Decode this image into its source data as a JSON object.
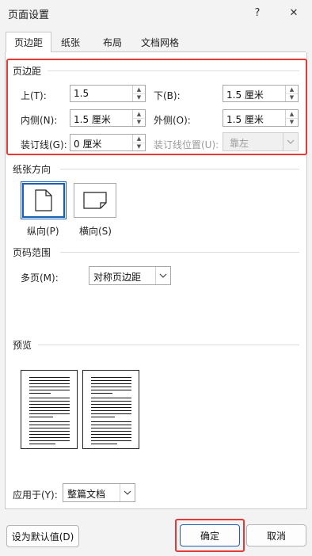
{
  "window": {
    "title": "页面设置",
    "help": "?",
    "close": "✕"
  },
  "tabs": [
    "页边距",
    "纸张",
    "布局",
    "文档网格"
  ],
  "margins": {
    "group_title": "页边距",
    "top_label": "上(T):",
    "top_value": "1.5",
    "bottom_label": "下(B):",
    "bottom_value": "1.5 厘米",
    "inside_label": "内侧(N):",
    "inside_value": "1.5 厘米",
    "outside_label": "外侧(O):",
    "outside_value": "1.5 厘米",
    "gutter_label": "装订线(G):",
    "gutter_value": "0 厘米",
    "gutter_pos_label": "装订线位置(U):",
    "gutter_pos_value": "靠左"
  },
  "orientation": {
    "group_title": "纸张方向",
    "portrait": "纵向(P)",
    "landscape": "横向(S)",
    "selected": "portrait"
  },
  "pages": {
    "group_title": "页码范围",
    "multiple_label": "多页(M):",
    "multiple_value": "对称页边距"
  },
  "preview": {
    "group_title": "预览"
  },
  "apply": {
    "label": "应用于(Y):",
    "value": "整篇文档"
  },
  "buttons": {
    "default": "设为默认值(D)",
    "ok": "确定",
    "cancel": "取消"
  },
  "colors": {
    "highlight": "#e53935",
    "accent": "#1a5fb4"
  }
}
